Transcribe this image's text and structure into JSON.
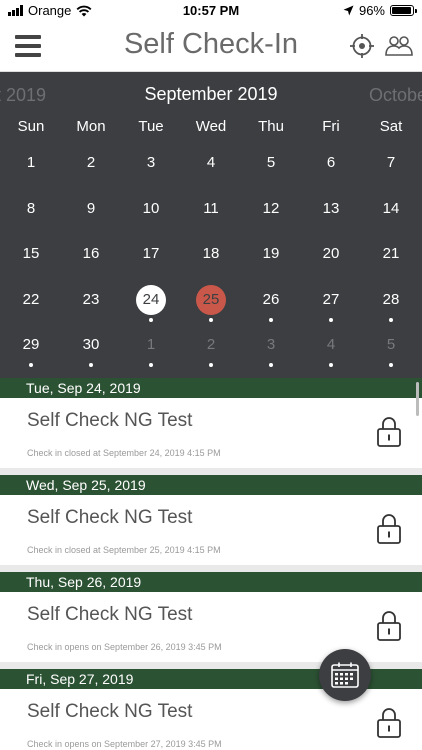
{
  "status": {
    "carrier": "Orange",
    "time": "10:57 PM",
    "battery": "96%",
    "battery_level": 0.96
  },
  "header": {
    "title": "Self Check-In",
    "menu_icon": "hamburger-menu-icon",
    "locate_icon": "crosshair-locate-icon",
    "group_icon": "group-people-icon"
  },
  "calendar": {
    "prev_month": "t 2019",
    "month": "September 2019",
    "next_month": "Octobe",
    "weekdays": [
      "Sun",
      "Mon",
      "Tue",
      "Wed",
      "Thu",
      "Fri",
      "Sat"
    ],
    "today": "24",
    "selected": "25",
    "colors": {
      "background": "#3c3e41",
      "selected": "#c9584a",
      "today": "#ffffff"
    },
    "weeks": [
      [
        {
          "d": "1"
        },
        {
          "d": "2"
        },
        {
          "d": "3"
        },
        {
          "d": "4"
        },
        {
          "d": "5"
        },
        {
          "d": "6"
        },
        {
          "d": "7"
        }
      ],
      [
        {
          "d": "8"
        },
        {
          "d": "9"
        },
        {
          "d": "10"
        },
        {
          "d": "11"
        },
        {
          "d": "12"
        },
        {
          "d": "13"
        },
        {
          "d": "14"
        }
      ],
      [
        {
          "d": "15"
        },
        {
          "d": "16"
        },
        {
          "d": "17"
        },
        {
          "d": "18"
        },
        {
          "d": "19"
        },
        {
          "d": "20"
        },
        {
          "d": "21"
        }
      ],
      [
        {
          "d": "22"
        },
        {
          "d": "23"
        },
        {
          "d": "24",
          "today": true,
          "dot": true
        },
        {
          "d": "25",
          "selected": true,
          "dot": true
        },
        {
          "d": "26",
          "dot": true
        },
        {
          "d": "27",
          "dot": true
        },
        {
          "d": "28",
          "dot": true
        }
      ],
      [
        {
          "d": "29",
          "dot": true
        },
        {
          "d": "30",
          "dot": true
        },
        {
          "d": "1",
          "other": true,
          "dot": true
        },
        {
          "d": "2",
          "other": true,
          "dot": true
        },
        {
          "d": "3",
          "other": true,
          "dot": true
        },
        {
          "d": "4",
          "other": true,
          "dot": true
        },
        {
          "d": "5",
          "other": true,
          "dot": true
        }
      ]
    ]
  },
  "events": [
    {
      "date": "Tue, Sep 24, 2019",
      "name": "Self Check NG Test",
      "status": "Check in closed at September 24, 2019 4:15 PM"
    },
    {
      "date": "Wed, Sep 25, 2019",
      "name": "Self Check NG Test",
      "status": "Check in closed at September 25, 2019 4:15 PM"
    },
    {
      "date": "Thu, Sep 26, 2019",
      "name": "Self Check NG Test",
      "status": "Check in opens on September 26, 2019 3:45 PM"
    },
    {
      "date": "Fri, Sep 27, 2019",
      "name": "Self Check NG Test",
      "status": "Check in opens on September 27, 2019 3:45 PM"
    }
  ],
  "accent_colors": {
    "section_header": "#2c5234"
  },
  "fab_icon": "calendar-grid-icon",
  "lock_icon": "lock-icon"
}
